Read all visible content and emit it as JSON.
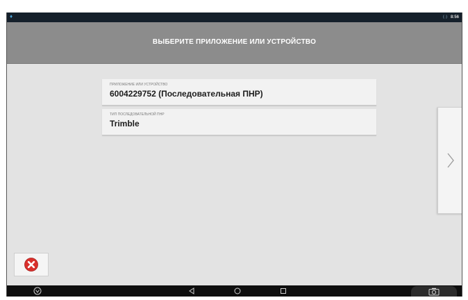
{
  "status_bar": {
    "left_icon": "location-pin-icon",
    "signal_text": "⟨·⟩",
    "time": "8:56"
  },
  "header": {
    "title": "ВЫБЕРИТЕ ПРИЛОЖЕНИЕ ИЛИ УСТРОЙСТВО"
  },
  "fields": [
    {
      "label": "ПРИЛОЖЕНИЕ ИЛИ УСТРОЙСТВО",
      "value": "6004229752 (Последовательная ПНР)"
    },
    {
      "label": "ТИП ПОСЛЕДОВАТЕЛЬНОЙ ПНР",
      "value": "Trimble"
    }
  ],
  "buttons": {
    "next_icon": "chevron-right-icon",
    "cancel_icon": "close-circle-icon"
  },
  "nav_bar": {
    "items": [
      "menu-icon",
      "back-icon",
      "home-icon",
      "recents-icon",
      "camera-icon"
    ]
  },
  "colors": {
    "title_bar": "#8c8c8c",
    "background": "#e3e3e3",
    "cancel_red": "#d9302c",
    "status_bar": "#15202b"
  }
}
